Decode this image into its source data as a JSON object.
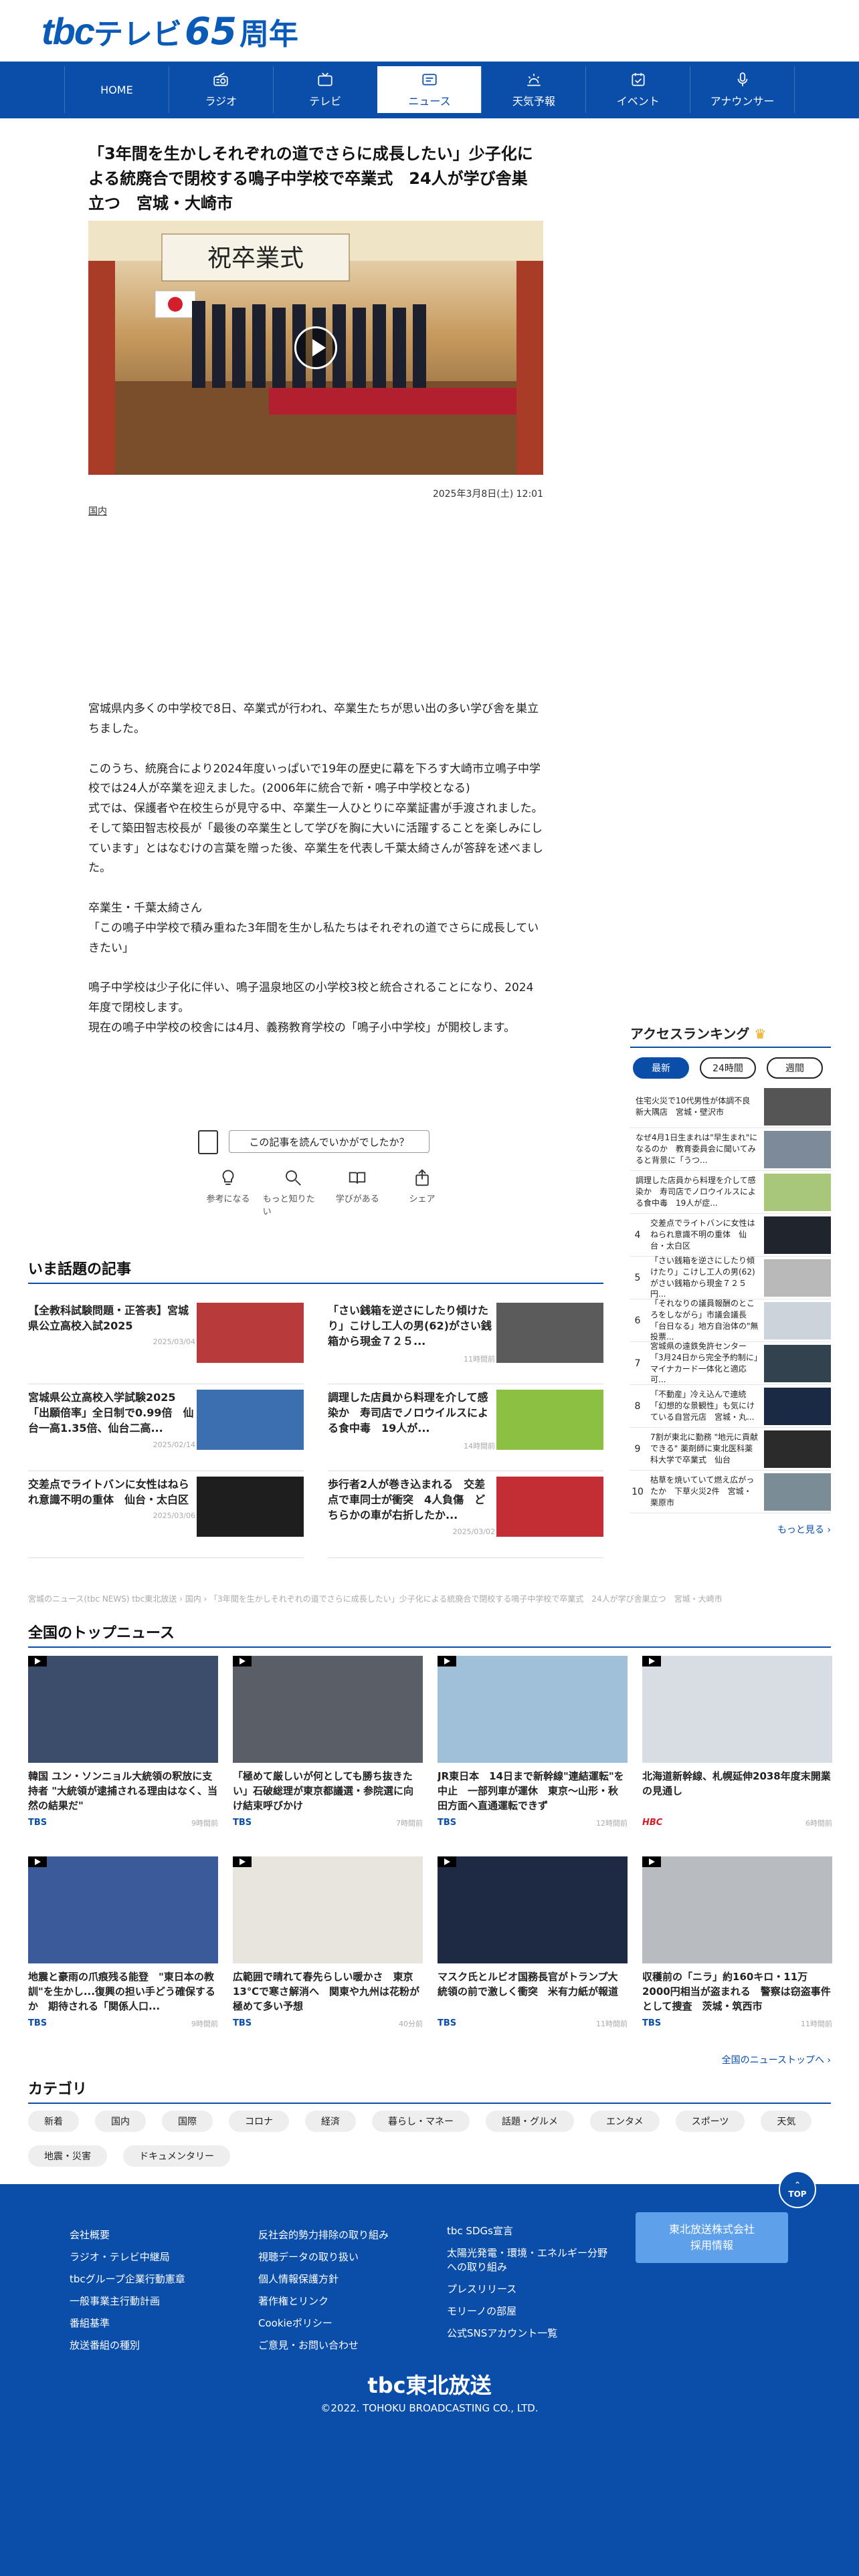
{
  "brand": {
    "l1": "tbc",
    "l2": "テレビ",
    "l3": "65",
    "l4": "周年"
  },
  "nav": [
    {
      "label": "HOME"
    },
    {
      "label": "ラジオ"
    },
    {
      "label": "テレビ"
    },
    {
      "label": "ニュース"
    },
    {
      "label": "天気予報"
    },
    {
      "label": "イベント"
    },
    {
      "label": "アナウンサー"
    }
  ],
  "article": {
    "title": "「3年間を生かしそれぞれの道でさらに成長したい」少子化による統廃合で閉校する鳴子中学校で卒業式　24人が学び舎巣立つ　宮城・大崎市",
    "date": "2025年3月8日(土) 12:01",
    "category": "国内",
    "paragraphs": [
      "宮城県内多くの中学校で8日、卒業式が行われ、卒業生たちが思い出の多い学び舎を巣立ちました。",
      "このうち、統廃合により2024年度いっぱいで19年の歴史に幕を下ろす大崎市立鳴子中学校では24人が卒業を迎えました。(2006年に統合で新・鳴子中学校となる)\n式では、保護者や在校生らが見守る中、卒業生一人ひとりに卒業証書が手渡されました。\nそして築田智志校長が「最後の卒業生として学びを胸に大いに活躍することを楽しみにしています」とはなむけの言葉を贈った後、卒業生を代表し千葉太綺さんが答辞を述べました。",
      "卒業生・千葉太綺さん\n「この鳴子中学校で積み重ねた3年間を生かし私たちはそれぞれの道でさらに成長していきたい」",
      "鳴子中学校は少子化に伴い、鳴子温泉地区の小学校3校と統合されることになり、2024年度で閉校します。\n現在の鳴子中学校の校舎には4月、義務教育学校の「鳴子小中学校」が開校します。"
    ],
    "feedback_label": "この記事を読んでいかがでしたか？",
    "reactions": [
      {
        "label": "参考になる"
      },
      {
        "label": "もっと知りたい"
      },
      {
        "label": "学びがある"
      },
      {
        "label": "シェア"
      }
    ]
  },
  "trending": {
    "title": "いま話題の記事",
    "items": [
      {
        "title": "【全教科試験問題・正答表】宮城県公立高校入試2025",
        "date": "2025/03/04"
      },
      {
        "title": "「さい銭箱を逆さにしたり傾けたり」こけし工人の男(62)がさい銭箱から現金７２５...",
        "date": "11時間前"
      },
      {
        "title": "宮城県公立高校入学試験2025「出願倍率」全日制で0.99倍　仙台一高1.35倍、仙台二高...",
        "date": "2025/02/14"
      },
      {
        "title": "調理した店員から料理を介して感染か　寿司店でノロウイルスによる食中毒　19人が...",
        "date": "14時間前"
      },
      {
        "title": "交差点でライトバンに女性はねられ意識不明の重体　仙台・太白区",
        "date": "2025/03/06"
      },
      {
        "title": "歩行者2人が巻き込まれる　交差点で車同士が衝突　4人負傷　どちらかの車が右折したか...",
        "date": "2025/03/02"
      }
    ]
  },
  "ranking": {
    "title": "アクセスランキング",
    "tabs": [
      "最新",
      "24時間",
      "週間"
    ],
    "items": [
      {
        "rank": "1",
        "text": "住宅火災で10代男性が体調不良　新大隅店　宮城・壁沢市"
      },
      {
        "rank": "2",
        "text": "なぜ4月1日生まれは\"早生まれ\"になるのか　教育委員会に聞いてみると背景に「うつ..."
      },
      {
        "rank": "3",
        "text": "調理した店員から料理を介して感染か　寿司店でノロウイルスによる食中毒　19人が症..."
      },
      {
        "rank": "4",
        "text": "交差点でライトバンに女性はねられ意識不明の重体　仙台・太白区"
      },
      {
        "rank": "5",
        "text": "「さい銭箱を逆さにしたり傾けたり」こけし工人の男(62)がさい銭箱から現金７２５円..."
      },
      {
        "rank": "6",
        "text": "「それなりの議員報酬のところをしながら」市議会議長「台日なる」地方自治体の\"無投票..."
      },
      {
        "rank": "7",
        "text": "宮城県の遠鉄免許センター「3月24日から完全予約制に」マイナカード一体化と適応可..."
      },
      {
        "rank": "8",
        "text": "「不動産」冷え込んで連続「幻想的な景観性」も気にけている自営元店　宮城・丸..."
      },
      {
        "rank": "9",
        "text": "7割が東北に勤務 \"地元に貢献できる\" 薬剤師に東北医科薬科大学で卒業式　仙台"
      },
      {
        "rank": "10",
        "text": "枯草を焼いていて燃え広がったか　下草火災2件　宮城・栗原市"
      }
    ],
    "more": "もっと見る ›"
  },
  "breadcrumb": "宮城のニュース(tbc NEWS) tbc東北放送 › 国内 › 「3年間を生かしそれぞれの道でさらに成長したい」少子化による統廃合で閉校する鳴子中学校で卒業式　24人が学び舎巣立つ　宮城・大崎市",
  "top_news": {
    "title": "全国のトップニュース",
    "items": [
      {
        "title": "韓国 ユン・ソンニョル大統領の釈放に支持者 \"大統領が逮捕される理由はなく、当然の結果だ\"",
        "source": "TBS",
        "date": "9時間前"
      },
      {
        "title": "「極めて厳しいが何としても勝ち抜きたい」石破総理が東京都議選・参院選に向け結束呼びかけ",
        "source": "TBS",
        "date": "7時間前"
      },
      {
        "title": "JR東日本　14日まで新幹線\"連結運転\"を中止　一部列車が運休　東京〜山形・秋田方面へ直通運転できず",
        "source": "TBS",
        "date": "12時間前"
      },
      {
        "title": "北海道新幹線、札幌延伸2038年度末開業の見通し",
        "source": "HBC",
        "date": "6時間前"
      },
      {
        "title": "地震と豪雨の爪痕残る能登　\"東日本の教訓\"を生かし...復興の担い手どう確保するか　期待される「関係人口...",
        "source": "TBS",
        "date": "9時間前"
      },
      {
        "title": "広範囲で晴れて春先らしい暖かさ　東京13℃で寒さ解消へ　関東や九州は花粉が極めて多い予想",
        "source": "TBS",
        "date": "40分前"
      },
      {
        "title": "マスク氏とルビオ国務長官がトランプ大統領の前で激しく衝突　米有力紙が報道",
        "source": "TBS",
        "date": "11時間前"
      },
      {
        "title": "収穫前の「ニラ」約160キロ・11万2000円相当が盗まれる　警察は窃盗事件として捜査　茨城・筑西市",
        "source": "TBS",
        "date": "11時間前"
      }
    ],
    "more": "全国のニューストップへ ›"
  },
  "categories": {
    "title": "カテゴリ",
    "items": [
      "新着",
      "国内",
      "国際",
      "コロナ",
      "経済",
      "暮らし・マネー",
      "話題・グルメ",
      "エンタメ",
      "スポーツ",
      "天気",
      "地震・災害",
      "ドキュメンタリー"
    ]
  },
  "footer": {
    "col1": [
      "会社概要",
      "ラジオ・テレビ中継局",
      "tbcグループ企業行動憲章",
      "一般事業主行動計画",
      "番組基準",
      "放送番組の種別"
    ],
    "col2": [
      "反社会的勢力排除の取り組み",
      "視聴データの取り扱い",
      "個人情報保護方針",
      "著作権とリンク",
      "Cookieポリシー",
      "ご意見・お問い合わせ"
    ],
    "col3": [
      "tbc SDGs宣言",
      "太陽光発電・環境・エネルギー分野への取り組み",
      "プレスリリース",
      "モリーノの部屋",
      "公式SNSアカウント一覧"
    ],
    "recruit_l1": "東北放送株式会社",
    "recruit_l2": "採用情報",
    "totop": "TOP",
    "logo": "tbc東北放送",
    "copyright": "©2022. TOHOKU BROADCASTING CO., LTD."
  },
  "colors": {
    "brand": "#0a4ea9",
    "accent": "#f0a20a",
    "rank_top": [
      "#f0a20a",
      "#ee8a22",
      "#e57a38"
    ]
  }
}
